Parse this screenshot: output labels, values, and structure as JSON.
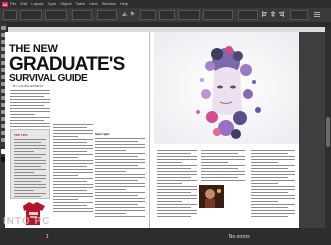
{
  "menubar": {
    "app_icon": "Id",
    "items": [
      "File",
      "Edit",
      "Layout",
      "Type",
      "Object",
      "Table",
      "View",
      "Window",
      "Help"
    ]
  },
  "toolbar": {
    "zoom": "100%"
  },
  "article": {
    "headline_line1": "THE NEW",
    "headline_line2": "GRADUATE'S",
    "headline_line3": "SURVIVAL GUIDE",
    "byline": "BY LAURA ERNEST",
    "sidebar_title": "TOP TIPS",
    "mid_heading": "Start right"
  },
  "statusbar": {
    "page_num": "1",
    "preflight": "No errors"
  },
  "watermark": "INTO PC",
  "colors": {
    "accent": "#c3182f",
    "app_brand": "#e31e79",
    "hero_purple": "#7a5aa8",
    "hero_pink": "#d4397e"
  }
}
